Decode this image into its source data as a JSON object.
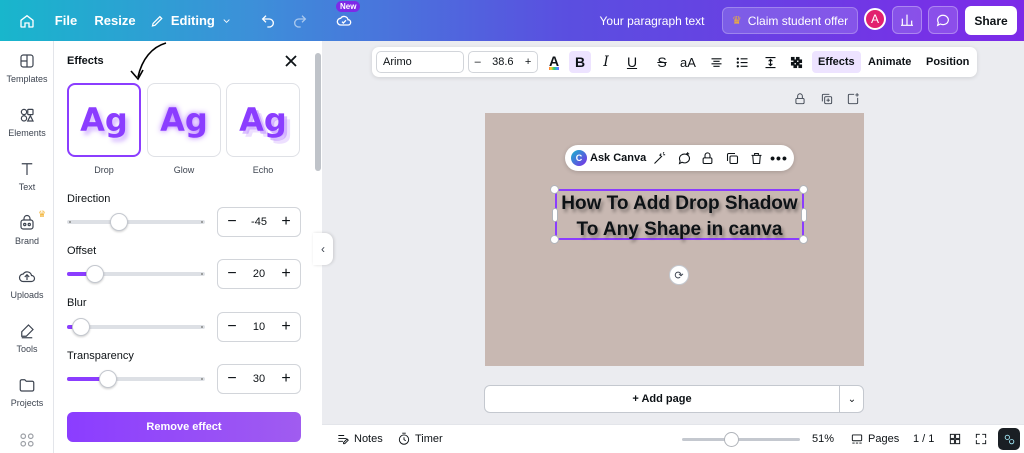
{
  "topbar": {
    "file_label": "File",
    "resize_label": "Resize",
    "editing_label": "Editing",
    "new_badge": "New",
    "doc_title": "Your paragraph text",
    "claim_label": "Claim student offer",
    "avatar_letter": "A",
    "share_label": "Share"
  },
  "rail": {
    "items": [
      {
        "label": "Templates",
        "icon": "templates-icon"
      },
      {
        "label": "Elements",
        "icon": "elements-icon"
      },
      {
        "label": "Text",
        "icon": "text-icon"
      },
      {
        "label": "Brand",
        "icon": "brand-icon"
      },
      {
        "label": "Uploads",
        "icon": "uploads-icon"
      },
      {
        "label": "Tools",
        "icon": "tools-icon"
      },
      {
        "label": "Projects",
        "icon": "projects-icon"
      }
    ]
  },
  "panel": {
    "title": "Effects",
    "effects": [
      {
        "label": "Drop",
        "preview": "Ag",
        "selected": true
      },
      {
        "label": "Glow",
        "preview": "Ag",
        "selected": false
      },
      {
        "label": "Echo",
        "preview": "Ag",
        "selected": false
      }
    ],
    "controls": [
      {
        "label": "Direction",
        "value": "-45",
        "slider_fraction": 0.38
      },
      {
        "label": "Offset",
        "value": "20",
        "slider_fraction": 0.2
      },
      {
        "label": "Blur",
        "value": "10",
        "slider_fraction": 0.1
      },
      {
        "label": "Transparency",
        "value": "30",
        "slider_fraction": 0.3
      }
    ],
    "remove_label": "Remove effect"
  },
  "text_toolbar": {
    "font": "Arimo",
    "font_size": "38.6",
    "minus": "–",
    "plus": "+",
    "bold": "B",
    "italic": "I",
    "underline": "U",
    "strike": "S",
    "case": "aA",
    "effects_label": "Effects",
    "animate_label": "Animate",
    "position_label": "Position"
  },
  "canvas": {
    "ask_label": "Ask Canva",
    "ask_logo": "C",
    "text_line1": "How To Add Drop Shadow",
    "text_line2": "To Any Shape  in canva",
    "page_color": "#c8b8b2",
    "add_page_label": "+ Add page"
  },
  "bottombar": {
    "notes_label": "Notes",
    "timer_label": "Timer",
    "zoom": "51%",
    "zoom_fraction": 0.51,
    "pages_label": "Pages",
    "page_count": "1 / 1"
  },
  "colors": {
    "accent": "#8b3dff",
    "topbar_start": "#18b6cc",
    "topbar_end": "#7d2ae8"
  }
}
